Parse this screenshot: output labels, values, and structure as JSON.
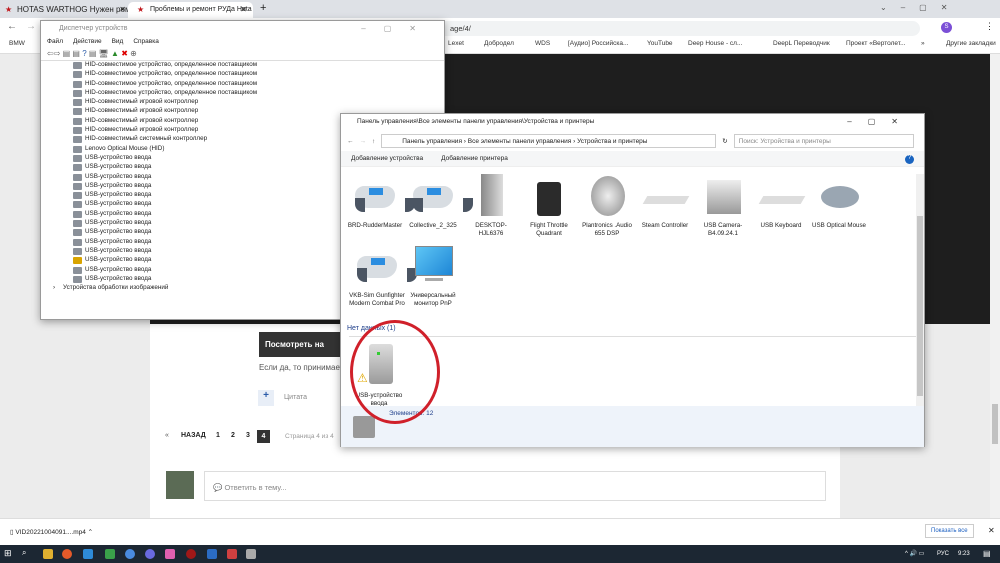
{
  "browser": {
    "tabs": [
      {
        "label": "HOTAS WARTHOG Нужен ремо"
      },
      {
        "label": "Проблемы и ремонт РУДа Hota"
      }
    ],
    "url_visible": "age/4/",
    "bookmarks": [
      "BMW",
      "Lexet",
      "Добродел",
      "WDS",
      "[Аудио] Российска...",
      "YouTube",
      "Deep House - сл...",
      "DeepL Переводчик",
      "Проект «Вертолет...",
      "»",
      "Другие закладки"
    ],
    "profile_initial": "S"
  },
  "devmgr": {
    "title": "Диспетчер устройств",
    "menu": [
      "Файл",
      "Действие",
      "Вид",
      "Справка"
    ],
    "items": [
      "HID-совместимое устройство, определенное поставщиком",
      "HID-совместимое устройство, определенное поставщиком",
      "HID-совместимое устройство, определенное поставщиком",
      "HID-совместимое устройство, определенное поставщиком",
      "HID-совместимый игровой контроллер",
      "HID-совместимый игровой контроллер",
      "HID-совместимый игровой контроллер",
      "HID-совместимый игровой контроллер",
      "HID-совместимый системный контроллер",
      "Lenovo Optical Mouse (HID)",
      "USB-устройство ввода",
      "USB-устройство ввода",
      "USB-устройство ввода",
      "USB-устройство ввода",
      "USB-устройство ввода",
      "USB-устройство ввода",
      "USB-устройство ввода",
      "USB-устройство ввода",
      "USB-устройство ввода",
      "USB-устройство ввода",
      "USB-устройство ввода",
      "USB-устройство ввода",
      "USB-устройство ввода",
      "USB-устройство ввода"
    ],
    "warning_index": 21,
    "category": "Устройства обработки изображений"
  },
  "devices": {
    "title": "Панель управления\\Все элементы панели управления\\Устройства и принтеры",
    "breadcrumb": [
      "Панель управления",
      "Все элементы панели управления",
      "Устройства и принтеры"
    ],
    "search_placeholder": "Поиск: Устройства и принтеры",
    "actions": [
      "Добавление устройства",
      "Добавление принтера"
    ],
    "items": [
      {
        "name": "BRD-RudderMaster",
        "icon": "gamepad"
      },
      {
        "name": "Collective_2_325",
        "icon": "gamepad"
      },
      {
        "name": "DESKTOP-HJL6376",
        "icon": "computer"
      },
      {
        "name": "Flight Throttle Quadrant",
        "icon": "throttle"
      },
      {
        "name": "Plantronics .Audio 655 DSP",
        "icon": "speaker"
      },
      {
        "name": "Steam Controller",
        "icon": "keyboard"
      },
      {
        "name": "USB Camera-B4.09.24.1",
        "icon": "camera"
      },
      {
        "name": "USB Keyboard",
        "icon": "keyboard"
      },
      {
        "name": "USB Optical Mouse",
        "icon": "mouse"
      },
      {
        "name": "VKB-Sim Gunfighter Modern Combat Pro",
        "icon": "gamepad"
      },
      {
        "name": "Универсальный монитор PnP",
        "icon": "monitor"
      }
    ],
    "nodata_header": "Нет данных (1)",
    "nodata_item": "USB-устройство ввода",
    "status": "Элементов: 12"
  },
  "forum": {
    "watch": "Посмотреть на",
    "text": "Если да, то принимает",
    "quote": "Цитата",
    "prev": "НАЗАД",
    "pages": [
      "1",
      "2",
      "3",
      "4"
    ],
    "current": "4",
    "page_info": "Страница 4 из 4",
    "reply_placeholder": "Ответить в тему..."
  },
  "downloads": {
    "file": "VID20221004091....mp4",
    "show_all": "Показать все"
  },
  "taskbar": {
    "lang": "РУС",
    "time": "9:23"
  },
  "colors": {
    "annotation": "#d0202a",
    "accent": "#1a73e8"
  }
}
